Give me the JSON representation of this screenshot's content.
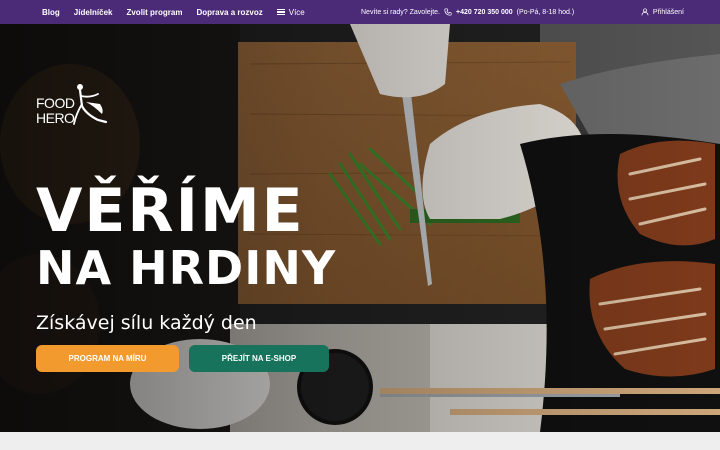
{
  "topbar": {
    "nav": [
      "Blog",
      "Jídelníček",
      "Zvolit program",
      "Doprava a rozvoz"
    ],
    "more_label": "Více",
    "help_text": "Nevíte si rady? Zavolejte.",
    "phone": "+420 720 350 000",
    "hours": "(Po-Pá, 8-18 hod.)",
    "login_label": "Přihlášení"
  },
  "logo": {
    "line1": "FOOD",
    "line2": "HERO"
  },
  "hero": {
    "title_line1": "VĚŘÍME",
    "title_line2": "NA HRDINY",
    "tagline": "Získávej sílu každý den"
  },
  "buttons": {
    "program": "PROGRAM NA MÍRU",
    "eshop": "PŘEJÍT NA E-SHOP"
  },
  "colors": {
    "topbar": "#4b2a78",
    "orange": "#f29a2e",
    "green": "#17735b"
  },
  "icons": [
    "menu-icon",
    "phone-icon",
    "user-icon",
    "hero-figure-icon"
  ]
}
